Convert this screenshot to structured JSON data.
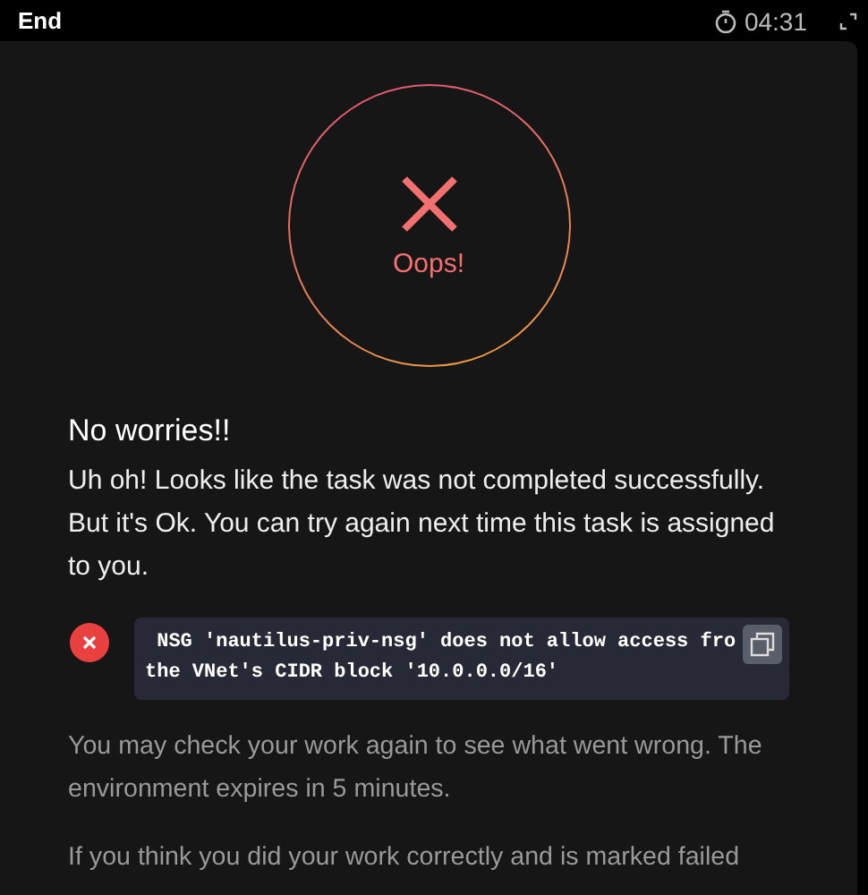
{
  "top_bar": {
    "end_tab": "End",
    "timer": "04:31"
  },
  "result": {
    "failed": true,
    "label": "Oops!"
  },
  "heading": "No worries!!",
  "message": "Uh oh! Looks like the task was not completed successfully. But it's Ok. You can try again next time this task is assigned to you.",
  "error": {
    "lines": [
      "NSG 'nautilus-priv-nsg' does not allow access fro",
      "the VNet's CIDR block '10.0.0.0/16'"
    ]
  },
  "notes": [
    "You may check your work again to see what went wrong. The environment expires in 5 minutes.",
    "If you think you did your work correctly and is marked failed"
  ]
}
